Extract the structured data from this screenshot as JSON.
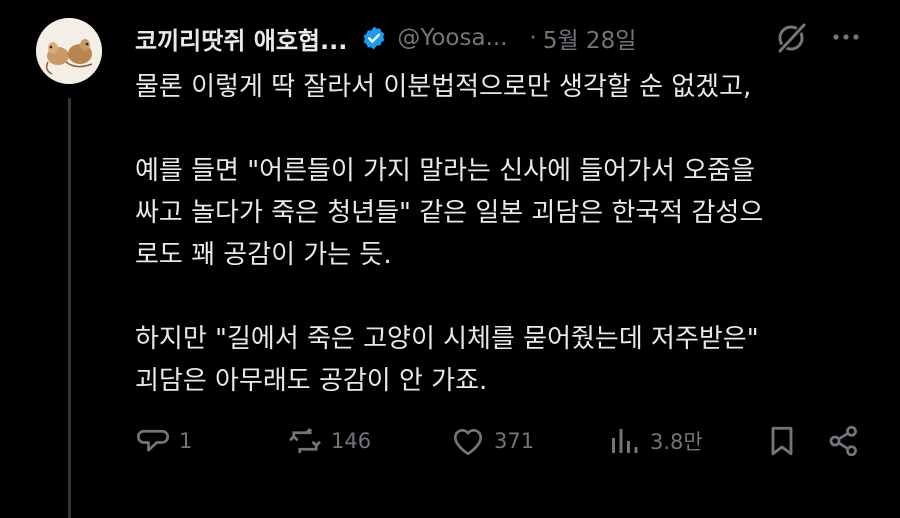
{
  "author": {
    "display_name": "코끼리땃쥐 애호협...",
    "handle": "@Yoosa...",
    "verified": true,
    "avatar_icon": "two-mice-illustration"
  },
  "post": {
    "separator": "·",
    "date": "5월 28일",
    "paragraphs": [
      [
        "물론 이렇게 딱 잘라서 이분법적으로만 생각할 순 없겠고,"
      ],
      [
        "예를 들면 \"어른들이 가지 말라는 신사에 들어가서 오줌을",
        "싸고 놀다가 죽은 청년들\" 같은 일본 괴담은 한국적 감성으",
        "로도 꽤 공감이 가는 듯."
      ],
      [
        "하지만 \"길에서 죽은 고양이 시체를 묻어줬는데 저주받은\"",
        "괴담은 아무래도 공감이 안 가죠."
      ]
    ]
  },
  "actions": {
    "replies": "1",
    "reposts": "146",
    "likes": "371",
    "views": "3.8만"
  },
  "colors": {
    "background": "#000000",
    "text": "#e7e9ea",
    "muted": "#71767b",
    "verified": "#1d9bf0"
  }
}
